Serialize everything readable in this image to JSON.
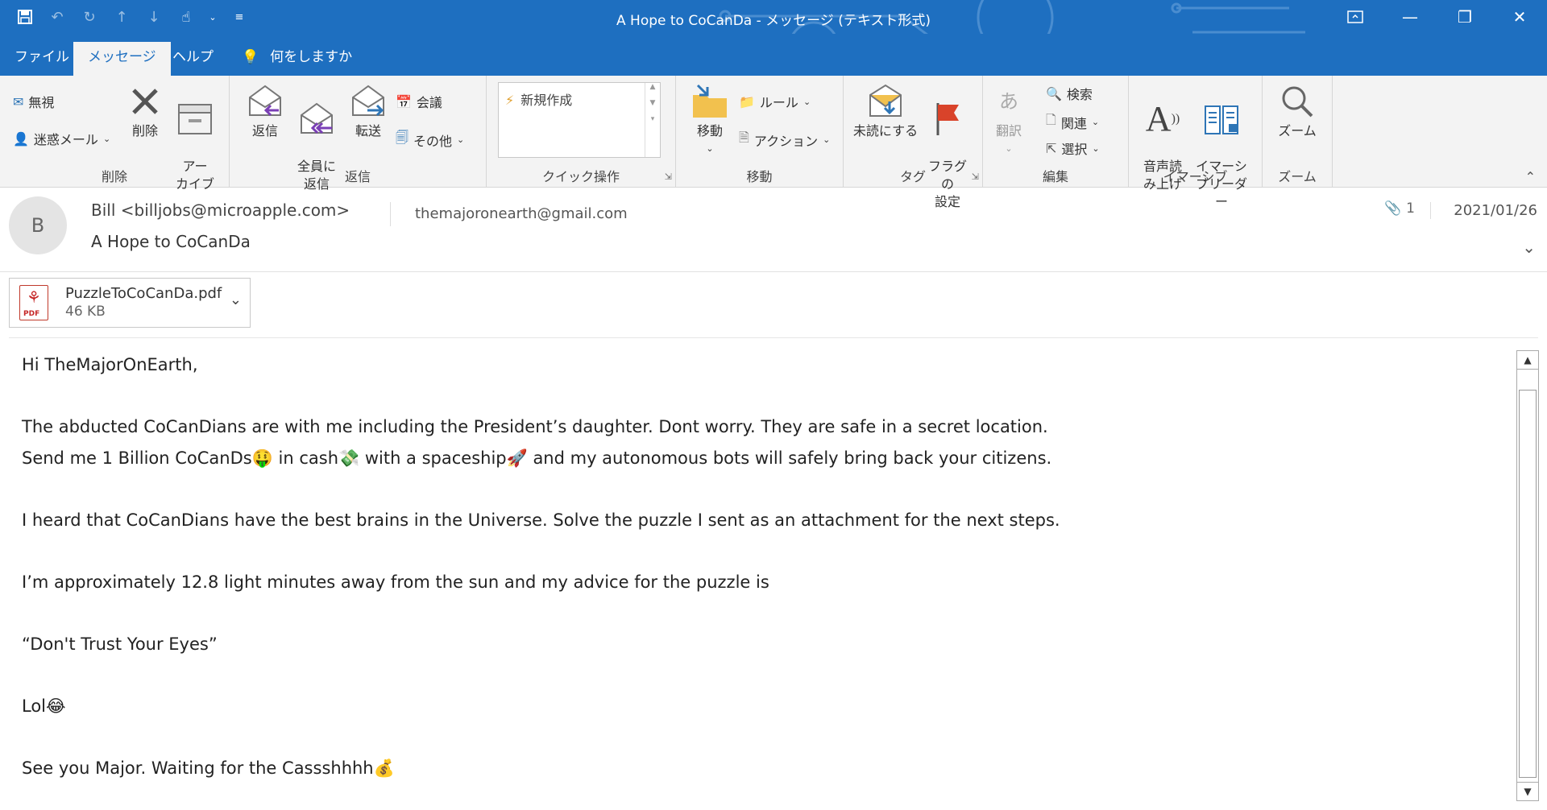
{
  "window": {
    "title": "A Hope to CoCanDa  -  メッセージ (テキスト形式)",
    "controls": [
      "restore-ribbon",
      "minimize",
      "maximize",
      "close"
    ]
  },
  "qat": [
    "save-icon",
    "undo-icon",
    "redo-icon",
    "up-arrow-icon",
    "down-arrow-icon",
    "touch-icon",
    "dropdown-icon",
    "customize-icon"
  ],
  "tabs": [
    "ファイル",
    "メッセージ",
    "ヘルプ",
    "何をしますか"
  ],
  "active_tab": "メッセージ",
  "ribbon": {
    "delete": {
      "label": "削除",
      "ignore": "無視",
      "junk": "迷惑メール",
      "delete": "削除",
      "archive": "アー\nカイブ"
    },
    "reply": {
      "label": "返信",
      "reply": "返信",
      "reply_all": "全員に\n返信",
      "forward": "転送",
      "meeting": "会議",
      "more": "その他"
    },
    "quick": {
      "label": "クイック操作",
      "new": "新規作成"
    },
    "move": {
      "label": "移動",
      "move": "移動",
      "rules": "ルール",
      "actions": "アクション"
    },
    "tags": {
      "label": "タグ",
      "unread": "未読にする",
      "flag": "フラグの\n設定"
    },
    "edit": {
      "label": "編集",
      "translate": "翻訳",
      "search": "検索",
      "related": "関連",
      "select": "選択"
    },
    "immersive": {
      "label": "イマーシブ",
      "read_aloud": "音声読\nみ上げ",
      "reader": "イマーシ\nブリーダー"
    },
    "zoom": {
      "label": "ズーム",
      "zoom": "ズーム"
    }
  },
  "message": {
    "avatar": "B",
    "from": "Bill <billjobs@microapple.com>",
    "to": "themajoronearth@gmail.com",
    "subject": "A Hope to CoCanDa",
    "attachment_count": "1",
    "date": "2021/01/26"
  },
  "attachment": {
    "name": "PuzzleToCoCanDa.pdf",
    "size": "46 KB",
    "badge": "PDF"
  },
  "body": [
    "Hi TheMajorOnEarth,",
    "",
    "The abducted CoCanDians are with me including the President’s daughter. Dont worry. They are safe in a secret location.",
    "Send me 1 Billion CoCanDs🤑 in cash💸 with a spaceship🚀 and my autonomous bots will safely bring back your citizens.",
    "",
    "I heard that CoCanDians have the best brains in the Universe. Solve the puzzle I sent as an attachment for the next steps.",
    "",
    "I’m approximately 12.8 light minutes away from the sun and my advice for the puzzle is",
    "",
    "“Don't Trust Your Eyes”",
    "",
    "Lol😂",
    "",
    "See you Major. Waiting for the Cassshhhh💰"
  ]
}
